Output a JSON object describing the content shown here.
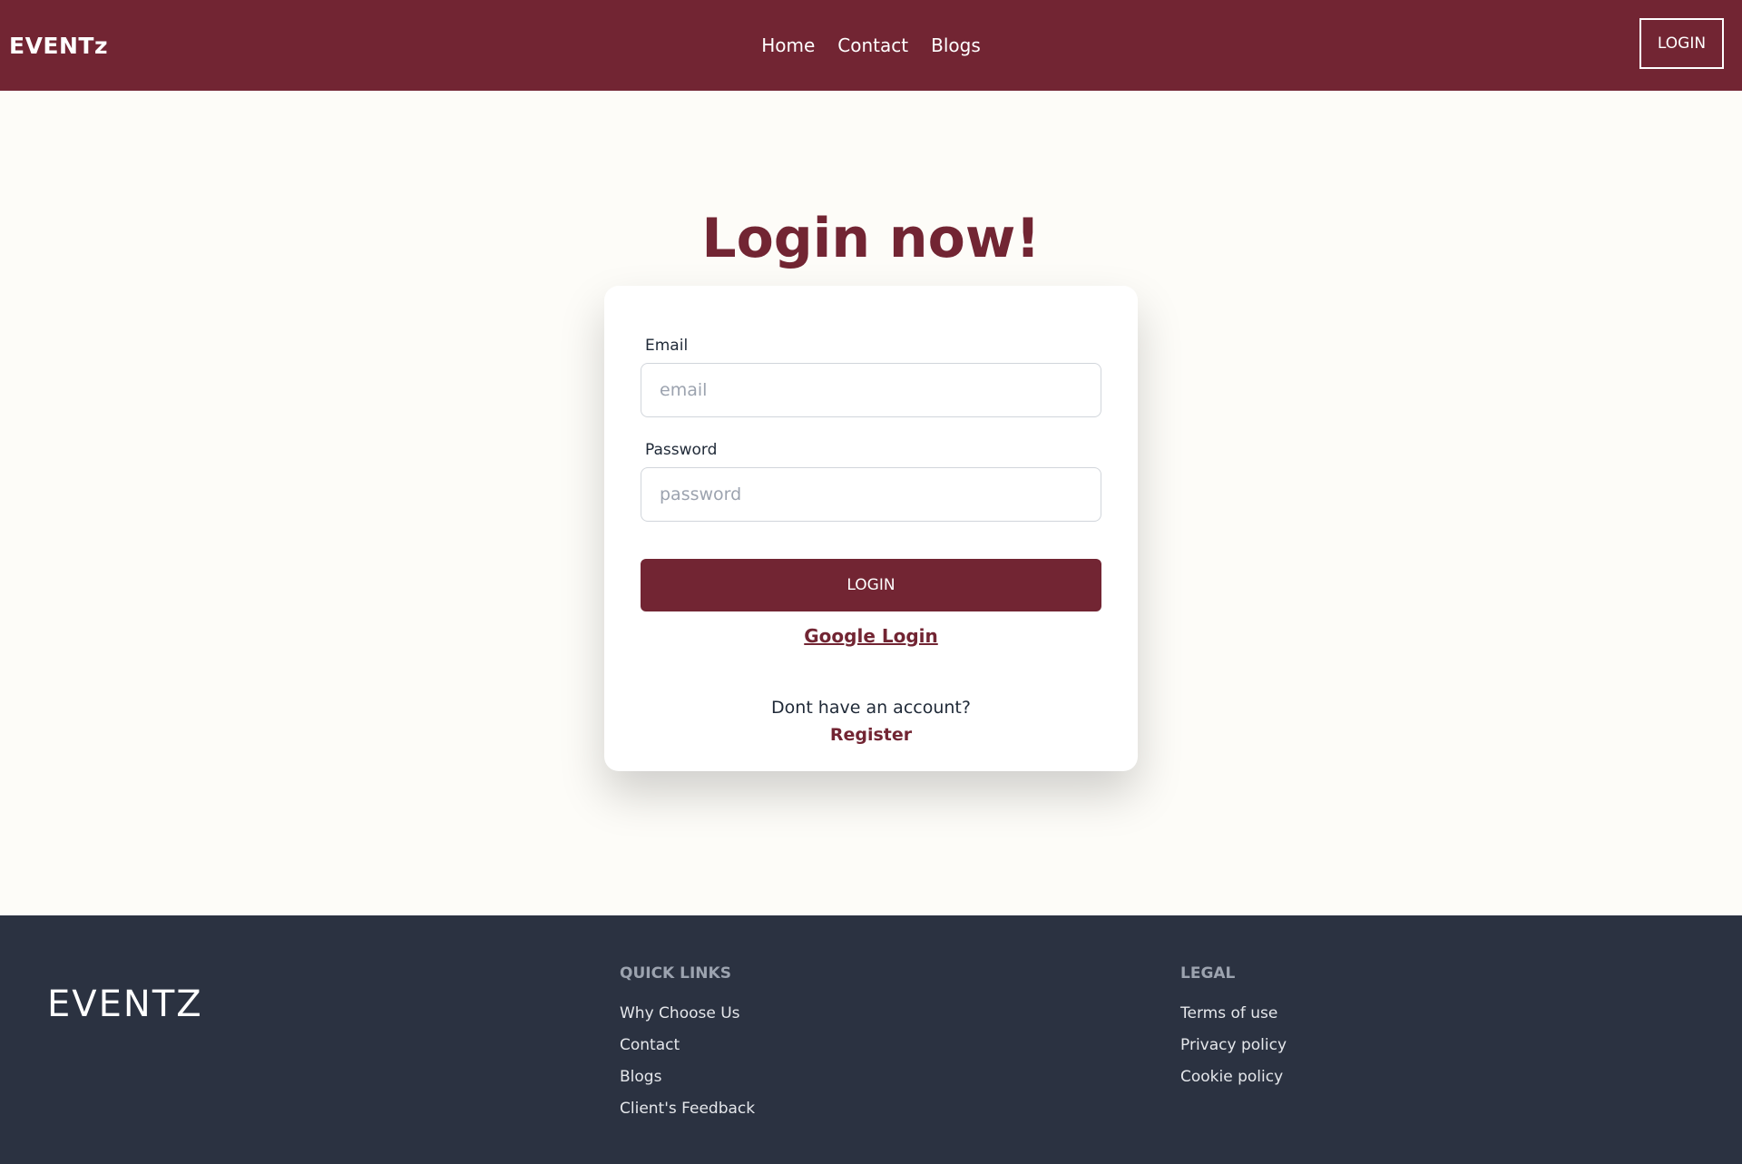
{
  "header": {
    "brand": "EVENTz",
    "nav": [
      "Home",
      "Contact",
      "Blogs"
    ],
    "login_label": "LOGIN"
  },
  "main": {
    "title": "Login now!",
    "email_label": "Email",
    "email_placeholder": "email",
    "password_label": "Password",
    "password_placeholder": "password",
    "login_button": "LOGIN",
    "google_login": "Google Login",
    "no_account_text": "Dont have an account?",
    "register_link": "Register"
  },
  "footer": {
    "brand": "EVENTZ",
    "quick_links": {
      "heading": "QUICK LINKS",
      "items": [
        "Why Choose Us",
        "Contact",
        "Blogs",
        "Client's Feedback"
      ]
    },
    "legal": {
      "heading": "LEGAL",
      "items": [
        "Terms of use",
        "Privacy policy",
        "Cookie policy"
      ]
    }
  },
  "colors": {
    "brand": "#722533",
    "background": "#fdfcf8",
    "footer": "#2b3241"
  }
}
